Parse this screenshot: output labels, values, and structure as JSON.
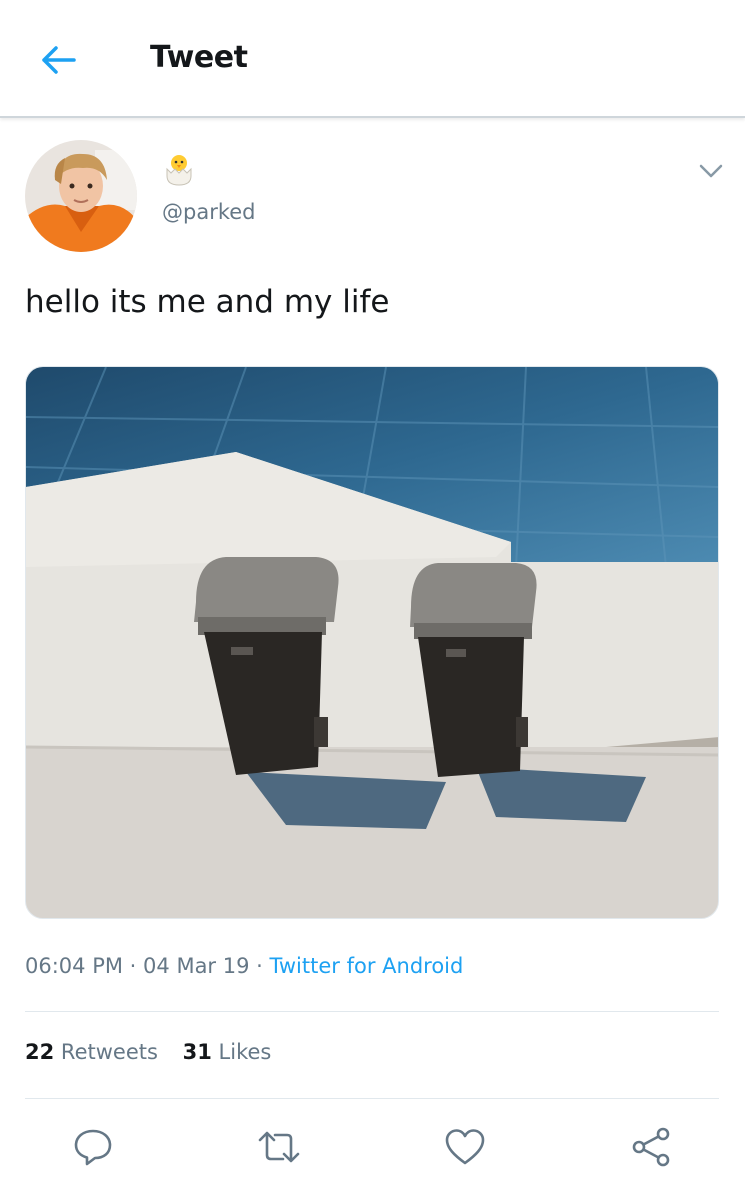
{
  "header": {
    "title": "Tweet",
    "back_icon": "arrow-left-icon",
    "accent": "#1da1f2"
  },
  "tweet": {
    "display_name_icon": "hatching-chick-emoji-icon",
    "handle": "@parked",
    "text": "hello its me and my life",
    "media_description_icon": "photo-two-trash-bins",
    "time": "06:04 PM",
    "date": "04 Mar 19",
    "source": "Twitter for Android",
    "separator": "·"
  },
  "stats": {
    "retweets_count": "22",
    "retweets_label": "Retweets",
    "likes_count": "31",
    "likes_label": "Likes"
  },
  "actions": [
    "reply-icon",
    "retweet-icon",
    "like-icon",
    "share-icon"
  ],
  "colors": {
    "text": "#14171a",
    "secondary": "#657786",
    "link": "#1da1f2",
    "icon": "#657786"
  }
}
